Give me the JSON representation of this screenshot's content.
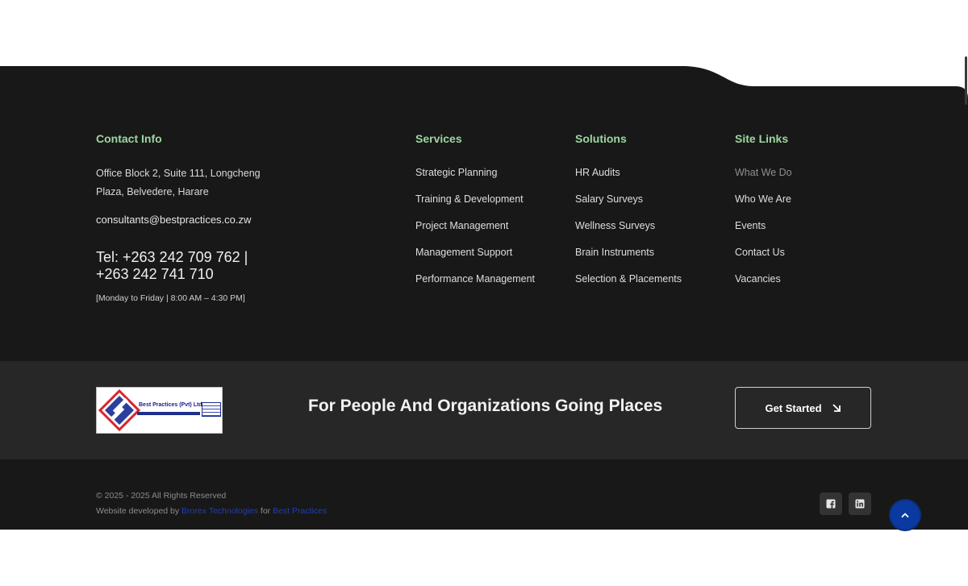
{
  "contact": {
    "title": "Contact Info",
    "address": "Office Block 2, Suite 111, Longcheng Plaza, Belvedere, Harare",
    "email": "consultants@bestpractices.co.zw",
    "tel": "Tel: +263 242 709 762 | +263 242 741 710",
    "hours": "[Monday to Friday  |  8:00 AM – 4:30 PM]"
  },
  "services": {
    "title": "Services",
    "items": [
      "Strategic Planning",
      "Training & Development",
      "Project Management",
      "Management Support",
      "Performance Management"
    ]
  },
  "solutions": {
    "title": "Solutions",
    "items": [
      "HR Audits",
      "Salary Surveys",
      "Wellness Surveys",
      "Brain Instruments",
      "Selection & Placements"
    ]
  },
  "site_links": {
    "title": "Site Links",
    "items": [
      "What We Do",
      "Who We Are",
      "Events",
      "Contact Us",
      "Vacancies"
    ]
  },
  "band": {
    "logo_name": "Best Practices (Pvt) Ltd",
    "tagline": "For People And Organizations Going Places",
    "cta_label": "Get Started"
  },
  "bottom": {
    "copyright": "© 2025 - 2025 All Rights Reserved",
    "dev_prefix": "Website developed by",
    "dev_company": "Brorex Technologies",
    "dev_for": "for",
    "dev_client": "Best Practices"
  },
  "icons": {
    "cta": "arrow-down-right-icon",
    "facebook": "facebook-icon",
    "linkedin": "linkedin-icon",
    "to_top": "chevron-up-icon"
  },
  "colors": {
    "footer_bg": "#181818",
    "band_bg": "#272727",
    "heading": "#9ed6a0",
    "link_accent": "#1f3fb0",
    "to_top": "#0a3aa0"
  }
}
